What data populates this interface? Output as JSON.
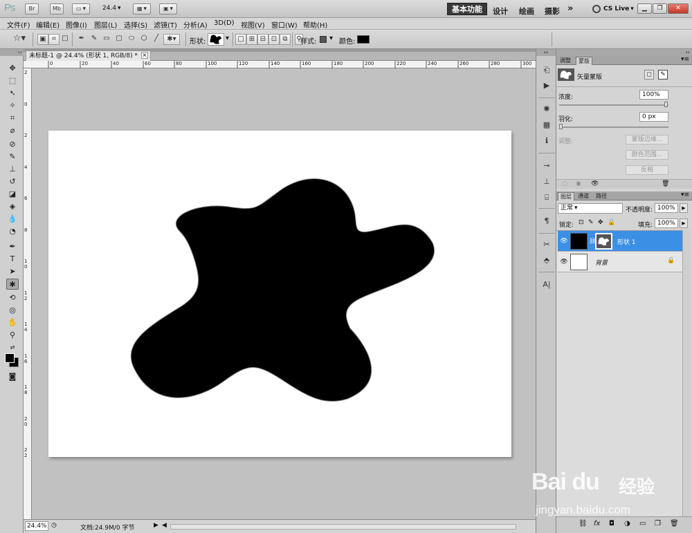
{
  "appbar": {
    "logo": "Ps",
    "br": "Br",
    "mb": "Mb",
    "zoom": "24.4",
    "workspace_active": "基本功能",
    "workspaces": [
      "设计",
      "绘画",
      "摄影"
    ],
    "more": "»",
    "cslive": "CS Live"
  },
  "menu": [
    "文件(F)",
    "编辑(E)",
    "图像(I)",
    "图层(L)",
    "选择(S)",
    "滤镜(T)",
    "分析(A)",
    "3D(D)",
    "视图(V)",
    "窗口(W)",
    "帮助(H)"
  ],
  "options": {
    "shape_label": "形状:",
    "style_label": "样式:",
    "color_label": "颜色:",
    "color": "#000000"
  },
  "document": {
    "tab_title": "未标题-1 @ 24.4% (形状 1, RGB/8) *",
    "close": "×"
  },
  "ruler_top": [
    "0",
    "20",
    "40",
    "60",
    "80",
    "100",
    "120",
    "140",
    "160",
    "180",
    "200",
    "220",
    "240",
    "260",
    "280",
    "300"
  ],
  "ruler_left": [
    "2",
    "0",
    "2",
    "4",
    "6",
    "8",
    "1 0",
    "1 2",
    "1 4",
    "1 6",
    "1 8",
    "2 0",
    "2 2"
  ],
  "status": {
    "zoom": "24.4%",
    "doc": "文档:24.9M/0 字节"
  },
  "masks_panel": {
    "tabs": [
      "调整",
      "蒙版"
    ],
    "mask_type": "矢量蒙版",
    "density_label": "浓度:",
    "density_value": "100%",
    "feather_label": "羽化:",
    "feather_value": "0 px",
    "refine_label": "调整:",
    "buttons": [
      "蒙版边缘...",
      "颜色范围...",
      "反相"
    ]
  },
  "layers_panel": {
    "tabs": [
      "图层",
      "通道",
      "路径"
    ],
    "blend_mode": "正常",
    "opacity_label": "不透明度:",
    "opacity_value": "100%",
    "lock_label": "锁定:",
    "fill_label": "填充:",
    "fill_value": "100%",
    "layers": [
      {
        "name": "形状 1"
      },
      {
        "name": "背景"
      }
    ]
  },
  "watermark": {
    "brand": "Bai du",
    "cn": "经验",
    "url": "jingyan.baidu.com"
  }
}
